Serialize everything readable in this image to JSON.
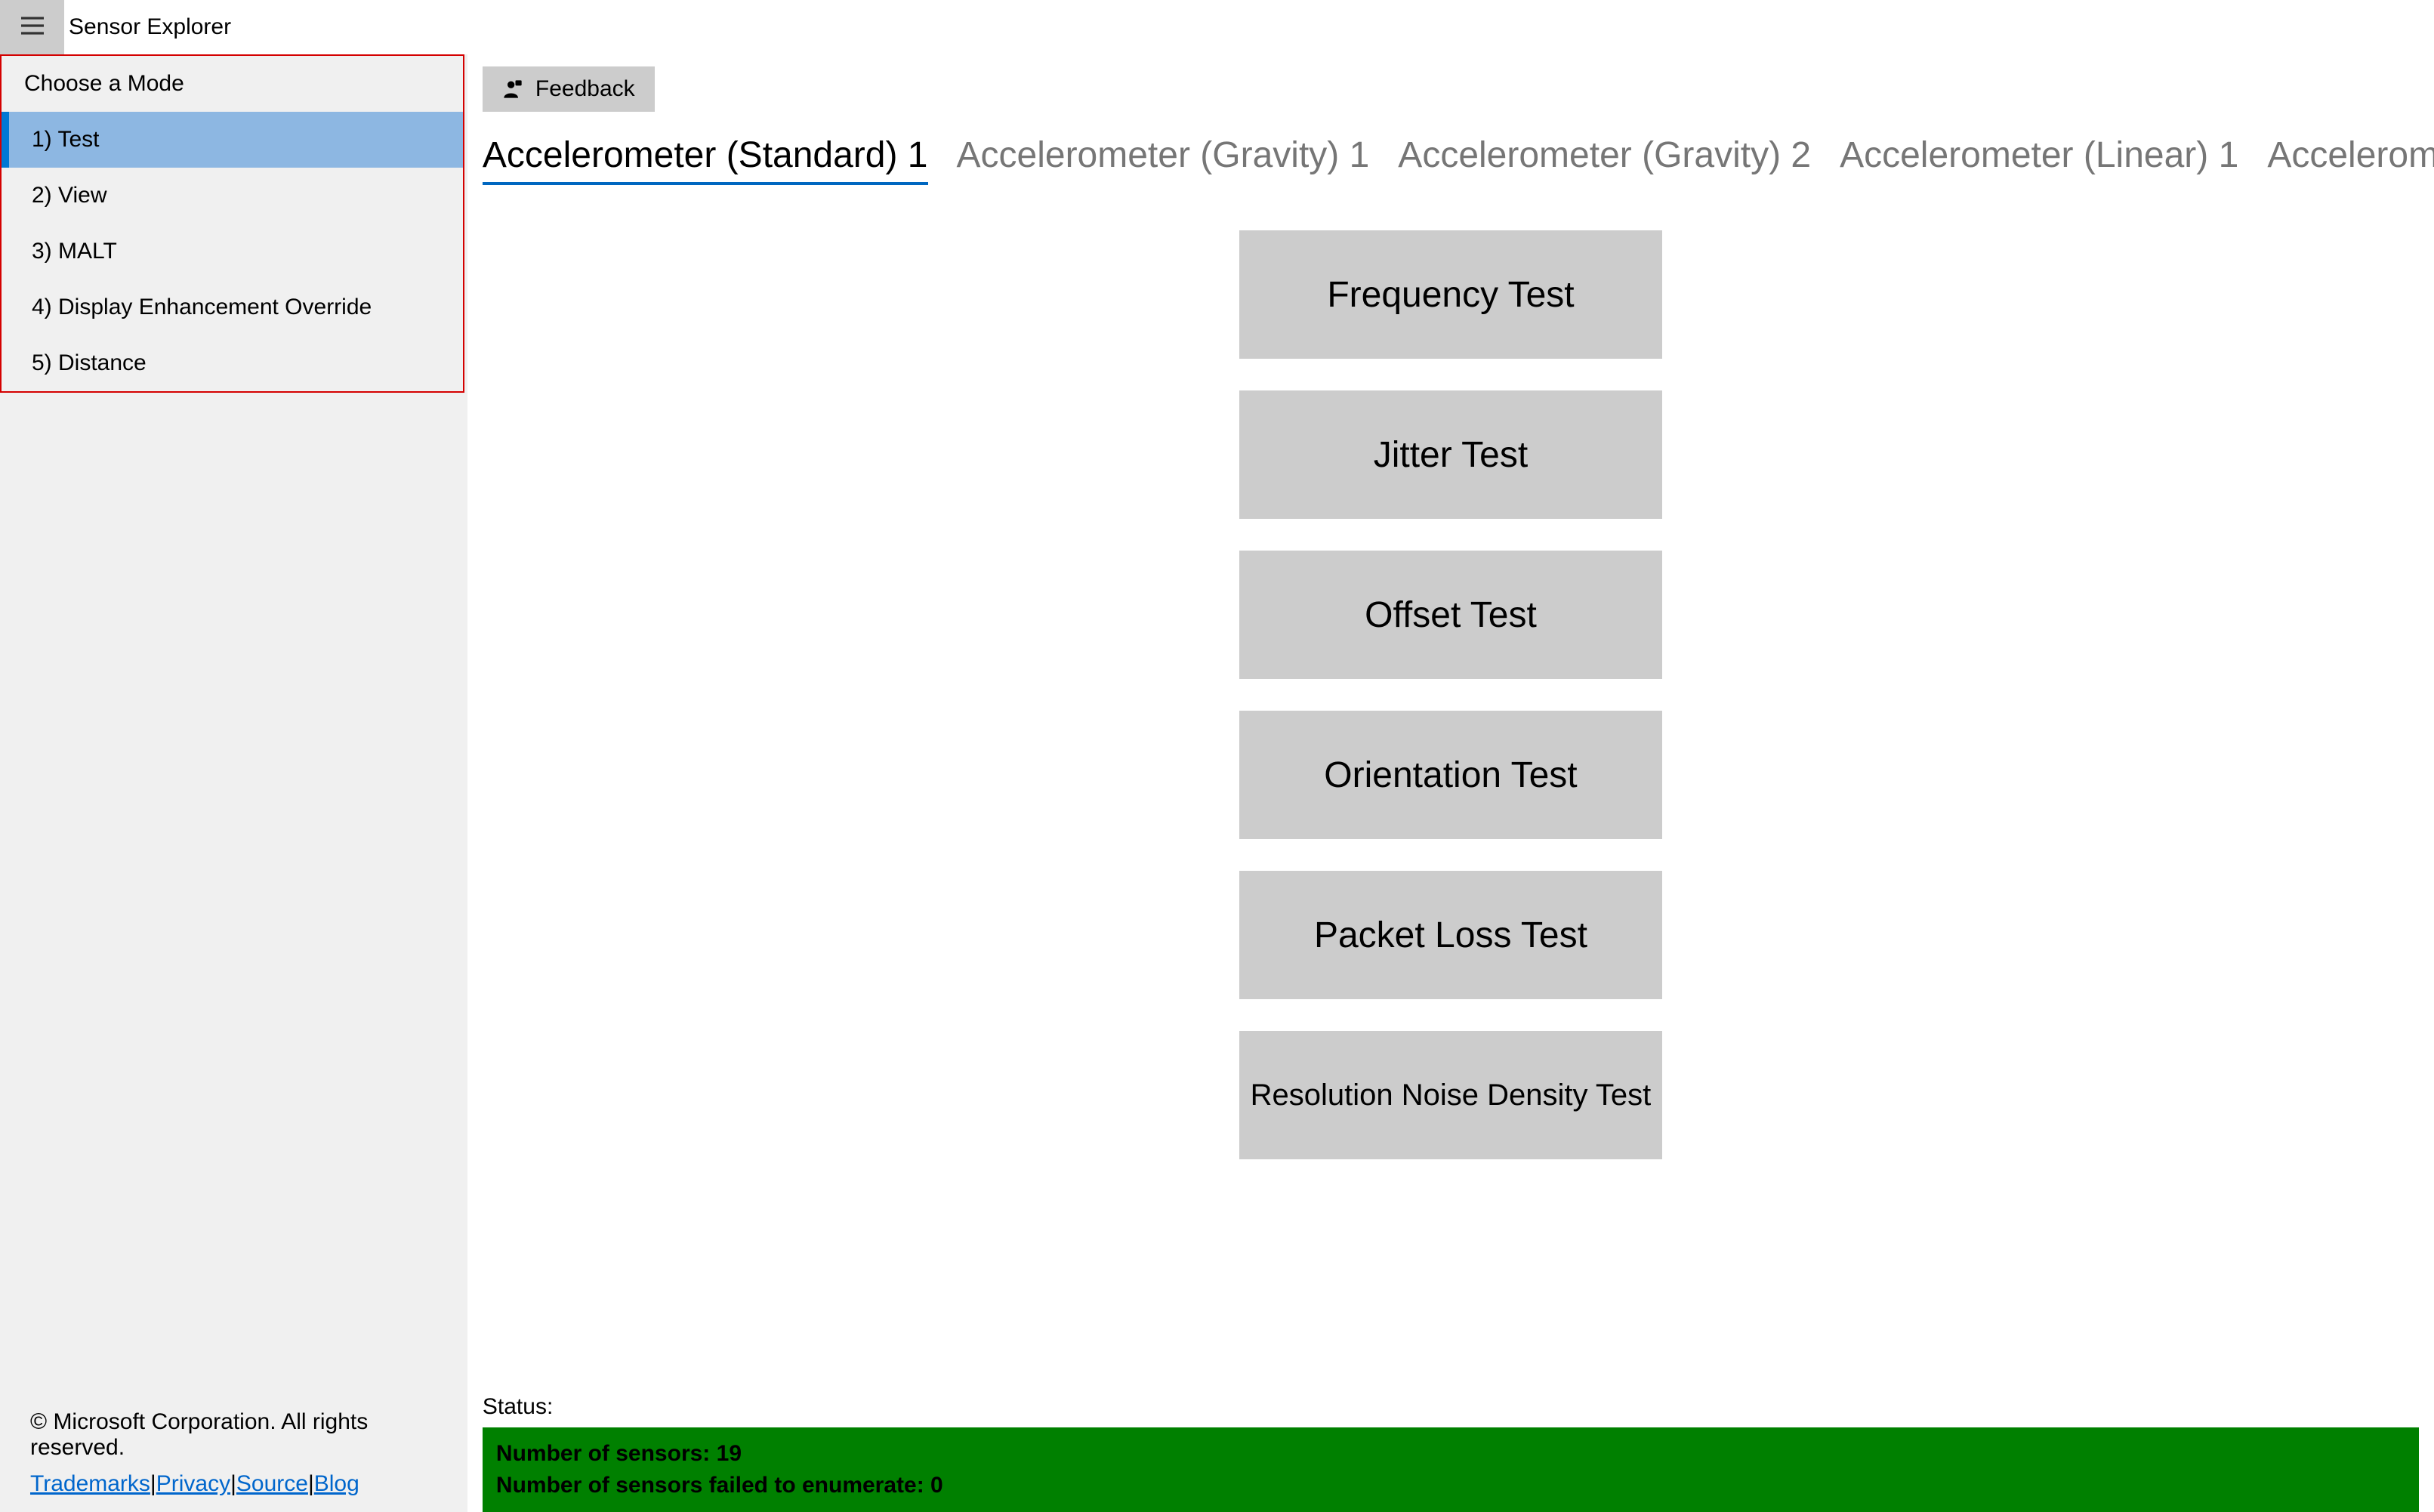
{
  "app": {
    "title": "Sensor Explorer"
  },
  "sidebar": {
    "header": "Choose a Mode",
    "items": [
      {
        "label": "1) Test"
      },
      {
        "label": "2) View"
      },
      {
        "label": "3) MALT"
      },
      {
        "label": "4) Display Enhancement Override"
      },
      {
        "label": "5) Distance"
      }
    ],
    "selectedIndex": 0
  },
  "footer": {
    "copyright": "© Microsoft Corporation. All rights reserved.",
    "links": [
      {
        "label": "Trademarks"
      },
      {
        "label": "Privacy"
      },
      {
        "label": "Source"
      },
      {
        "label": "Blog"
      }
    ]
  },
  "feedback": {
    "label": "Feedback"
  },
  "tabs": [
    {
      "label": "Accelerometer (Standard) 1",
      "active": true
    },
    {
      "label": "Accelerometer (Gravity) 1",
      "active": false
    },
    {
      "label": "Accelerometer (Gravity) 2",
      "active": false
    },
    {
      "label": "Accelerometer (Linear) 1",
      "active": false
    },
    {
      "label": "Accelerometer",
      "active": false
    }
  ],
  "tests": [
    {
      "label": "Frequency Test"
    },
    {
      "label": "Jitter Test"
    },
    {
      "label": "Offset Test"
    },
    {
      "label": "Orientation Test"
    },
    {
      "label": "Packet Loss Test"
    },
    {
      "label": "Resolution Noise Density Test"
    }
  ],
  "status": {
    "label": "Status:",
    "line1": "Number of sensors: 19",
    "line2": "Number of sensors failed to enumerate: 0"
  }
}
